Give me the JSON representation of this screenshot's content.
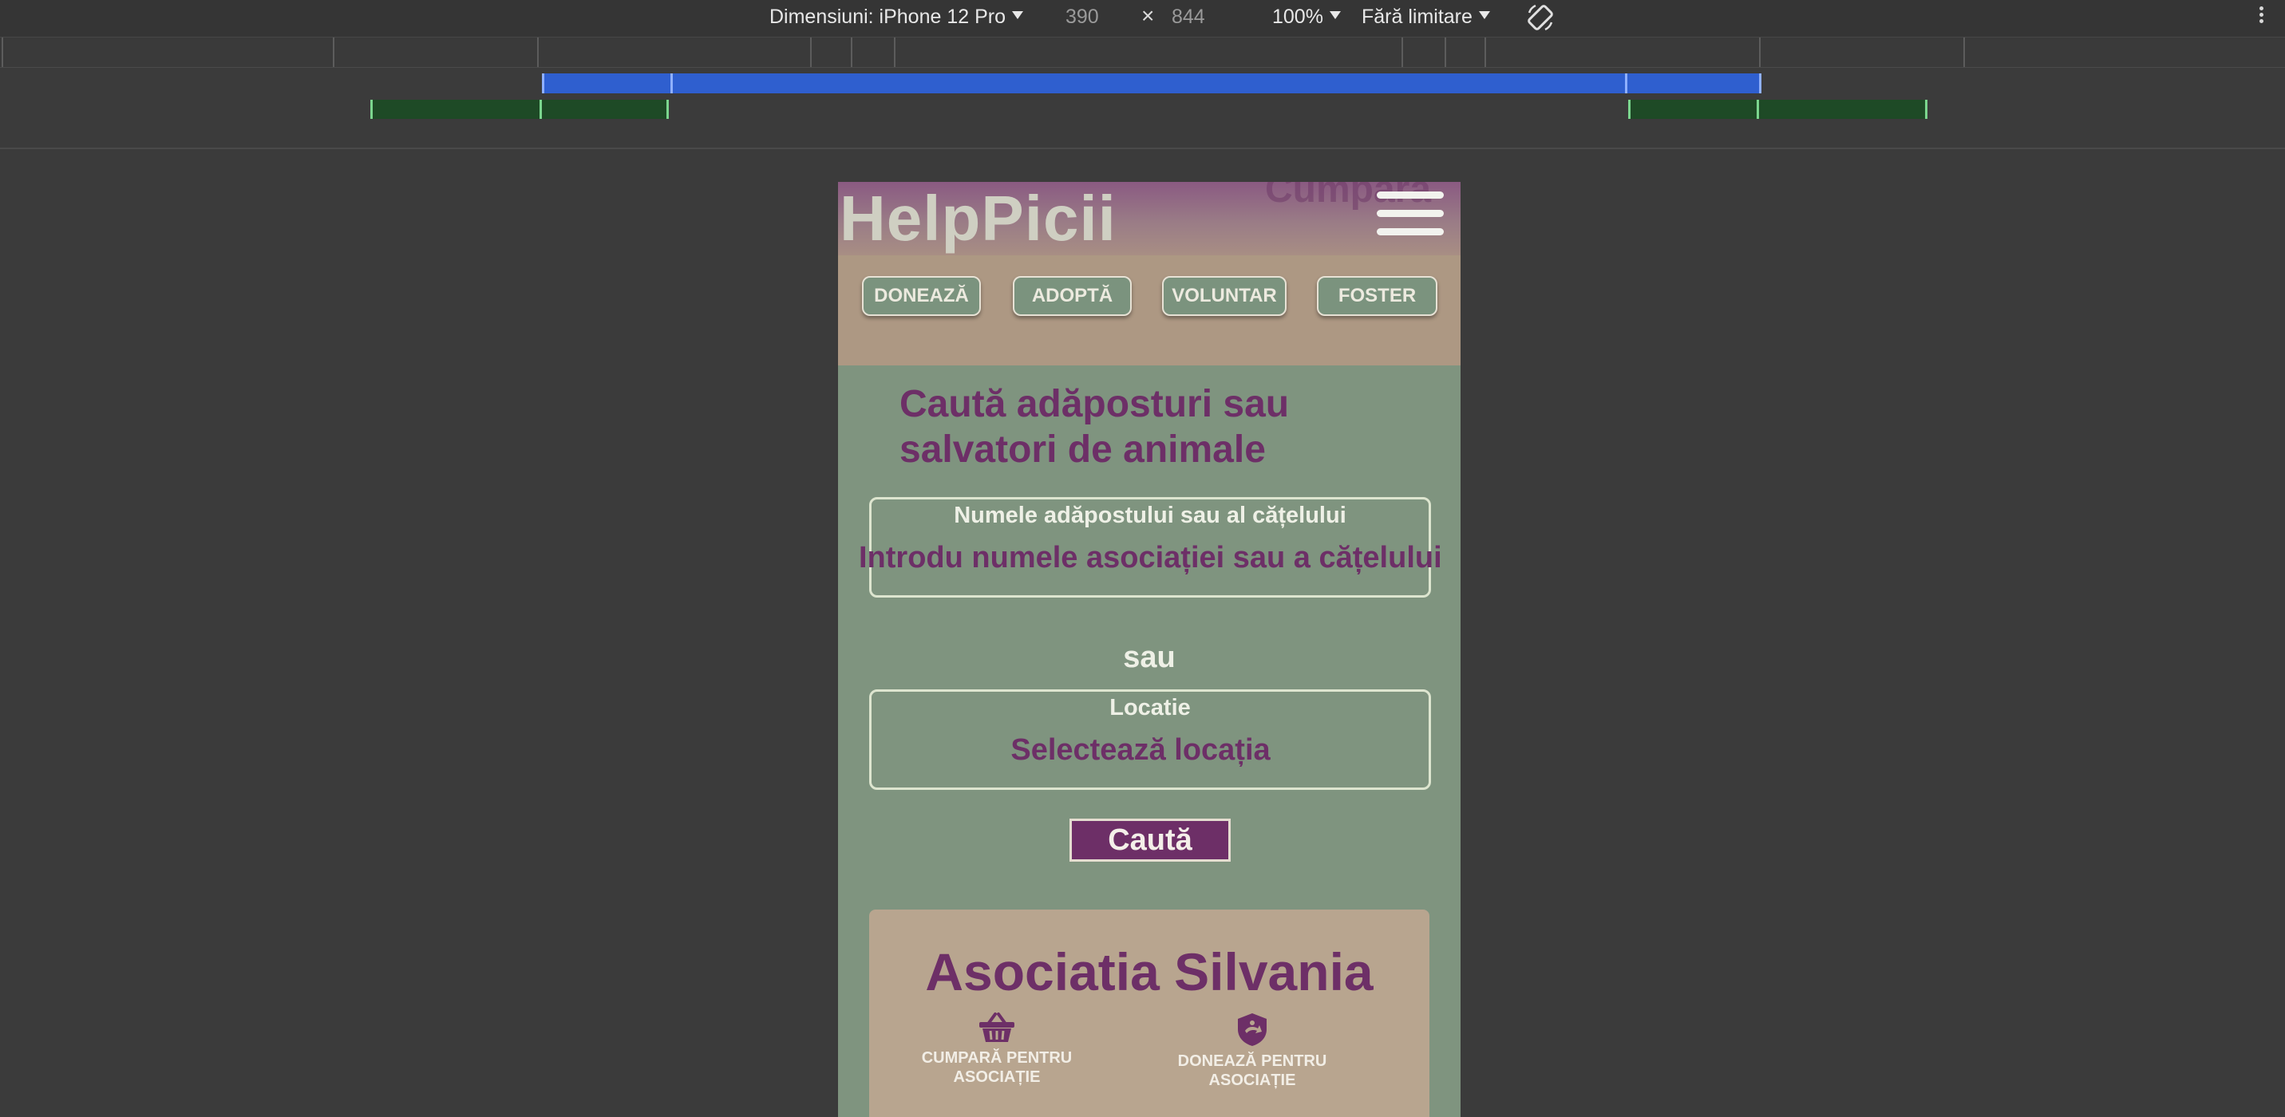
{
  "devtools": {
    "device_label": "Dimensiuni: iPhone 12 Pro",
    "width": "390",
    "times": "×",
    "height": "844",
    "zoom": "100%",
    "throttle": "Fără limitare"
  },
  "site": {
    "logo": "HelpPicii",
    "ghost_text": "Cumpără",
    "nav": [
      "DONEAZĂ",
      "ADOPTĂ",
      "VOLUNTAR",
      "FOSTER"
    ],
    "search_title": "Caută adăposturi sau salvatori de animale",
    "name_field": {
      "label": "Numele adăpostului sau al cățelului",
      "placeholder": "Introdu numele asociației sau a cățelului"
    },
    "or_text": "sau",
    "location_field": {
      "label": "Locatie",
      "value": "Selectează locația"
    },
    "search_button": "Caută",
    "association": {
      "name": "Asociatia Silvania",
      "buy_label": "CUMPARĂ PENTRU ASOCIAȚIE",
      "donate_label": "DONEAZĂ PENTRU ASOCIAȚIE"
    }
  },
  "colors": {
    "accent": "#6d2f67",
    "page_bg": "#7f947f",
    "nav_bg": "#ad9883",
    "card_bg": "#b8a58f",
    "mq_blue": "#2f5fcf",
    "mq_green": "#1e4a26"
  }
}
